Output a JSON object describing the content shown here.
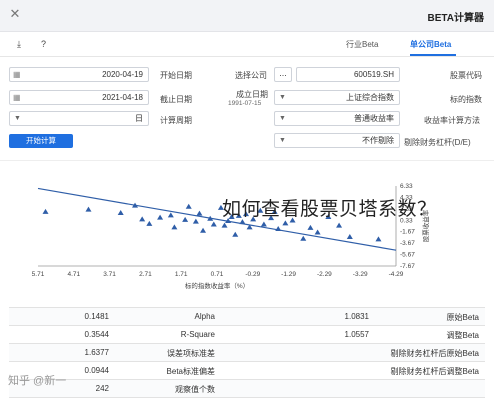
{
  "window": {
    "title": "BETA计算器",
    "close_icon": "close-icon"
  },
  "toolbar": {
    "download_icon": "download-icon",
    "help_icon": "help-icon"
  },
  "tabs": [
    {
      "label": "单公司Beta",
      "active": true
    },
    {
      "label": "行业Beta",
      "active": false
    }
  ],
  "form": {
    "stock_code": {
      "label": "股票代码",
      "value": "600519.SH"
    },
    "select_company": {
      "label": "选择公司",
      "button": "..."
    },
    "start_date": {
      "label": "开始日期",
      "value": "2020-04-19"
    },
    "benchmark": {
      "label": "标的指数",
      "value": "上证综合指数"
    },
    "listed_date": {
      "label": "成立日期",
      "value": "1991-07-15"
    },
    "end_date": {
      "label": "截止日期",
      "value": "2021-04-18"
    },
    "return_calc": {
      "label": "收益率计算方法",
      "value": "普通收益率"
    },
    "period": {
      "label": "计算周期",
      "value": "日"
    },
    "tax_adjust": {
      "label": "剔除财务杠杆(D/E)",
      "value": "不作剔除"
    },
    "calc_button": "开始计算"
  },
  "chart_data": {
    "type": "scatter",
    "title": "",
    "xlabel": "标的指数收益率（%）",
    "ylabel": "股票收益率",
    "x_ticks": [
      "5.71",
      "4.71",
      "3.71",
      "2.71",
      "1.71",
      "0.71",
      "-0.29",
      "-1.29",
      "-2.29",
      "-3.29",
      "-4.29"
    ],
    "y_ticks": [
      "6.33",
      "4.33",
      "2.33",
      "0.33",
      "-1.67",
      "-3.67",
      "-5.67",
      "-7.67"
    ],
    "xlim": [
      -4.29,
      5.71
    ],
    "ylim": [
      -7.67,
      6.33
    ],
    "series": [
      {
        "marker": "triangle",
        "color": "#2f5ea8",
        "points": [
          [
            -0.3,
            0.5
          ],
          [
            0.4,
            0.2
          ],
          [
            1.2,
            1.5
          ],
          [
            -1.0,
            -1.2
          ],
          [
            0.8,
            -0.4
          ],
          [
            2.0,
            1.2
          ],
          [
            -2.1,
            -1.8
          ],
          [
            0.1,
            1.1
          ],
          [
            -0.6,
            -0.4
          ],
          [
            1.6,
            0.4
          ],
          [
            3.4,
            1.6
          ],
          [
            -3.0,
            -2.6
          ],
          [
            0.6,
            2.5
          ],
          [
            -1.4,
            0.3
          ],
          [
            2.6,
            -0.3
          ],
          [
            0.2,
            -2.2
          ],
          [
            -0.9,
            1.8
          ],
          [
            1.1,
            -1.5
          ],
          [
            4.3,
            2.2
          ],
          [
            -2.7,
            -0.6
          ],
          [
            0.0,
            0.0
          ],
          [
            0.3,
            0.9
          ],
          [
            -0.2,
            -0.9
          ],
          [
            1.5,
            2.7
          ],
          [
            -1.7,
            -2.9
          ],
          [
            2.3,
            0.8
          ],
          [
            -0.5,
            2.0
          ],
          [
            0.9,
            0.6
          ],
          [
            -1.2,
            -0.2
          ],
          [
            5.5,
            1.8
          ],
          [
            -3.8,
            -3.0
          ],
          [
            1.9,
            -0.9
          ],
          [
            0.5,
            -0.6
          ],
          [
            -0.8,
            0.7
          ],
          [
            3.0,
            2.9
          ],
          [
            -2.4,
            0.9
          ],
          [
            1.3,
            0.1
          ],
          [
            -0.1,
            1.4
          ],
          [
            2.8,
            0.5
          ],
          [
            -1.9,
            -1.0
          ]
        ]
      }
    ],
    "regression_line": {
      "x": [
        -4.29,
        5.71
      ],
      "y": [
        -4.9,
        5.9
      ],
      "color": "#2f5ea8"
    }
  },
  "overlay_text": "如何查看股票贝塔系数？",
  "results": [
    {
      "k1": "原始Beta",
      "v1": "1.0831",
      "k2": "Alpha",
      "v2": "0.1481"
    },
    {
      "k1": "调整Beta",
      "v1": "1.0557",
      "k2": "R-Square",
      "v2": "0.3544"
    },
    {
      "k1": "剔除财务杠杆后原始Beta",
      "v1": "",
      "k2": "误差项标准差",
      "v2": "1.6377"
    },
    {
      "k1": "剔除财务杠杆后调整Beta",
      "v1": "",
      "k2": "Beta标准偏差",
      "v2": "0.0944"
    },
    {
      "k1": "",
      "v1": "",
      "k2": "观察值个数",
      "v2": "242"
    }
  ],
  "watermark": "知乎 @新一"
}
